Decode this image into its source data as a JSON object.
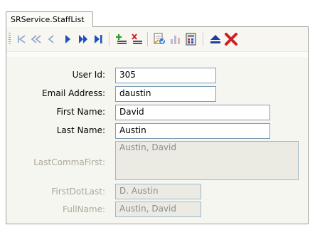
{
  "tab": {
    "label": "SRService.StaffList"
  },
  "toolbar": {
    "buttons": [
      {
        "name": "first-record-button",
        "icon": "first-icon"
      },
      {
        "name": "prev-page-button",
        "icon": "prev-page-icon"
      },
      {
        "name": "prev-record-button",
        "icon": "prev-icon"
      },
      {
        "name": "next-record-button",
        "icon": "next-icon"
      },
      {
        "name": "next-page-button",
        "icon": "next-page-icon"
      },
      {
        "name": "last-record-button",
        "icon": "last-icon"
      },
      {
        "name": "add-record-button",
        "icon": "add-icon"
      },
      {
        "name": "delete-record-button",
        "icon": "delete-icon"
      },
      {
        "name": "query-button",
        "icon": "query-icon"
      },
      {
        "name": "chart-button",
        "icon": "chart-icon"
      },
      {
        "name": "calculator-button",
        "icon": "calc-icon"
      },
      {
        "name": "eject-button",
        "icon": "eject-icon"
      },
      {
        "name": "close-button",
        "icon": "close-icon"
      }
    ],
    "colors": {
      "nav": "#1d4fbf",
      "add": "#2a9a2a",
      "delete": "#d02020"
    }
  },
  "form": {
    "user_id": {
      "label": "User Id:",
      "value": "305"
    },
    "email": {
      "label": "Email Address:",
      "value": "daustin"
    },
    "first_name": {
      "label": "First Name:",
      "value": "David"
    },
    "last_name": {
      "label": "Last Name:",
      "value": "Austin"
    },
    "last_comma_first": {
      "label": "LastCommaFirst:",
      "value": "Austin, David"
    },
    "first_dot_last": {
      "label": "FirstDotLast:",
      "value": "D. Austin"
    },
    "full_name": {
      "label": "FullName:",
      "value": "Austin, David"
    }
  }
}
